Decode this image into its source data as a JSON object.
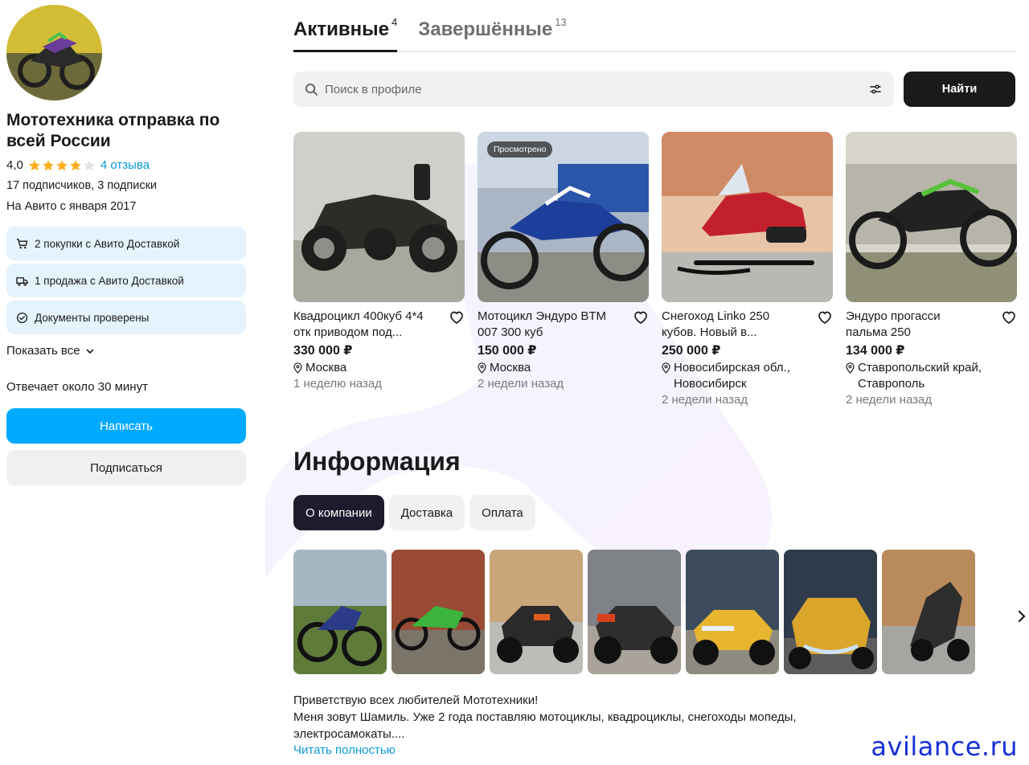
{
  "profile": {
    "name": "Мототехника отправка по всей России",
    "rating_value": "4,0",
    "rating_stars": 4,
    "rating_max": 5,
    "reviews": "4 отзыва",
    "followers": "17 подписчиков, 3 подписки",
    "member_since": "На Авито с января 2017",
    "badges": [
      {
        "icon": "cart-icon",
        "label": "2 покупки с Авито Доставкой"
      },
      {
        "icon": "truck-icon",
        "label": "1 продажа с Авито Доставкой"
      },
      {
        "icon": "check-circle-icon",
        "label": "Документы проверены"
      }
    ],
    "show_all": "Показать все",
    "reply_time": "Отвечает около 30 минут",
    "write_button": "Написать",
    "subscribe_button": "Подписаться"
  },
  "tabs": [
    {
      "label": "Активные",
      "count": "4",
      "active": true
    },
    {
      "label": "Завершённые",
      "count": "13",
      "active": false
    }
  ],
  "search": {
    "placeholder": "Поиск в профиле",
    "button": "Найти"
  },
  "listings": [
    {
      "title_line1": "Квадроцикл 400куб 4*4",
      "title_line2": "отк приводом под...",
      "price": "330 000 ₽",
      "location_line1": "Москва",
      "location_line2": "",
      "date": "1 неделю назад",
      "viewed": ""
    },
    {
      "title_line1": "Мотоцикл Эндуро BTM",
      "title_line2": "007 300 куб",
      "price": "150 000 ₽",
      "location_line1": "Москва",
      "location_line2": "",
      "date": "2 недели назад",
      "viewed": "Просмотрено"
    },
    {
      "title_line1": "Снегоход Linko 250",
      "title_line2": "кубов. Новый в...",
      "price": "250 000 ₽",
      "location_line1": "Новосибирская обл.,",
      "location_line2": "Новосибирск",
      "date": "2 недели назад",
      "viewed": ""
    },
    {
      "title_line1": "Эндуро прогасси",
      "title_line2": "пальма 250",
      "price": "134 000 ₽",
      "location_line1": "Ставропольский край,",
      "location_line2": "Ставрополь",
      "date": "2 недели назад",
      "viewed": ""
    }
  ],
  "info": {
    "title": "Информация",
    "pills": [
      {
        "label": "О компании",
        "active": true
      },
      {
        "label": "Доставка",
        "active": false
      },
      {
        "label": "Оплата",
        "active": false
      }
    ],
    "about_line1": "Приветствую всех любителей Мототехники!",
    "about_line2": "Меня зовут Шамиль. Уже 2 года поставляю мотоциклы, квадроциклы, снегоходы мопеды,",
    "about_line3": "электросамокаты....",
    "read_more": "Читать полностью"
  },
  "watermark": "avilance.ru",
  "colors": {
    "accent": "#00aaff",
    "link": "#0a99d6",
    "star": "#ffb021",
    "dark": "#1a1a1a"
  }
}
